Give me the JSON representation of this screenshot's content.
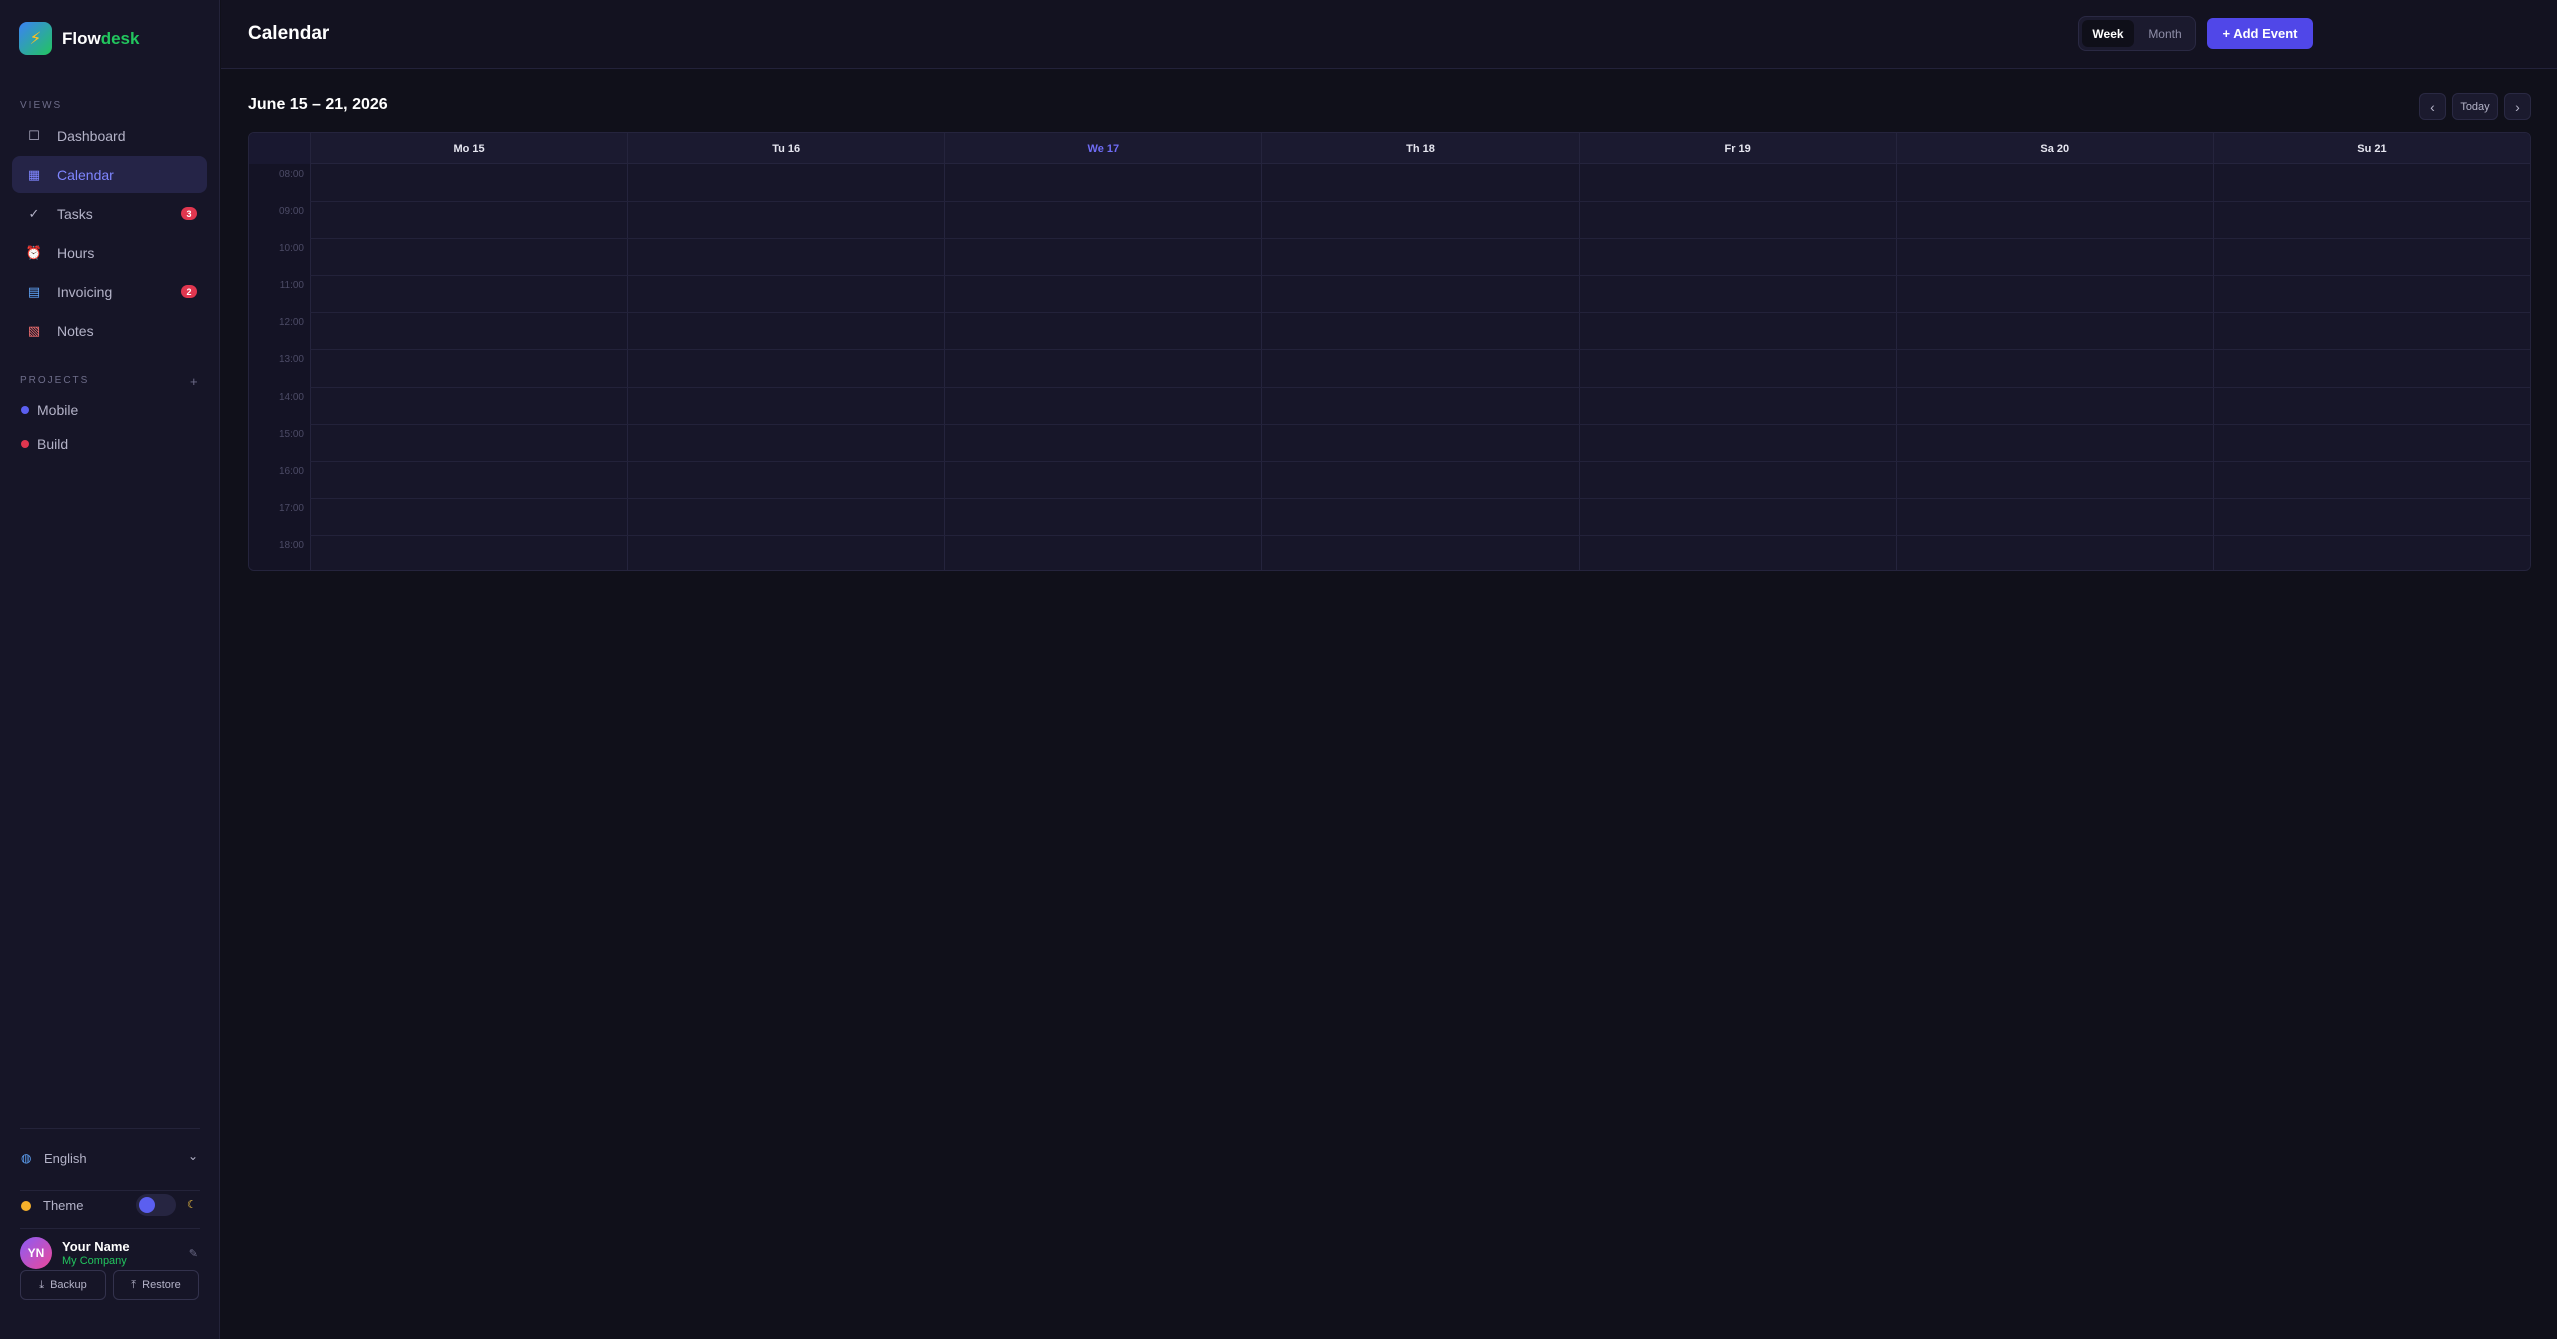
{
  "brand": {
    "name_main": "Flow",
    "name_accent": "desk",
    "logo_icon": "lightning-icon"
  },
  "sidebar": {
    "views_label": "VIEWS",
    "items": [
      {
        "label": "Dashboard",
        "icon": "square-icon",
        "badge": ""
      },
      {
        "label": "Calendar",
        "icon": "calendar-icon",
        "badge": "",
        "active": true
      },
      {
        "label": "Tasks",
        "icon": "check-icon",
        "badge": "3"
      },
      {
        "label": "Hours",
        "icon": "clock-icon",
        "badge": ""
      },
      {
        "label": "Invoicing",
        "icon": "invoice-icon",
        "badge": "2"
      },
      {
        "label": "Notes",
        "icon": "notes-icon",
        "badge": ""
      }
    ],
    "projects_label": "PROJECTS",
    "add_project": "+",
    "projects": [
      {
        "label": "Mobile",
        "color": "#5b5ff0"
      },
      {
        "label": "Build",
        "color": "#e0364f"
      }
    ],
    "language": "English",
    "theme_label": "Theme",
    "user": {
      "initials": "YN",
      "name": "Your Name",
      "company": "My Company"
    },
    "backup_label": "Backup",
    "restore_label": "Restore"
  },
  "header": {
    "title": "Calendar",
    "view_week": "Week",
    "view_month": "Month",
    "add_event": "+ Add Event"
  },
  "calendar": {
    "range": "June 15 – 21, 2026",
    "prev": "‹",
    "today": "Today",
    "next": "›",
    "days": [
      "Mo 15",
      "Tu 16",
      "We 17",
      "Th 18",
      "Fr 19",
      "Sa 20",
      "Su 21"
    ],
    "today_index": 2,
    "hours": [
      "08:00",
      "09:00",
      "10:00",
      "11:00",
      "12:00",
      "13:00",
      "14:00",
      "15:00",
      "16:00",
      "17:00",
      "18:00"
    ]
  },
  "colors": {
    "accent": "#5047e8",
    "today": "#6f6cf5",
    "brand_green": "#22c55e",
    "badge": "#e0364f"
  }
}
